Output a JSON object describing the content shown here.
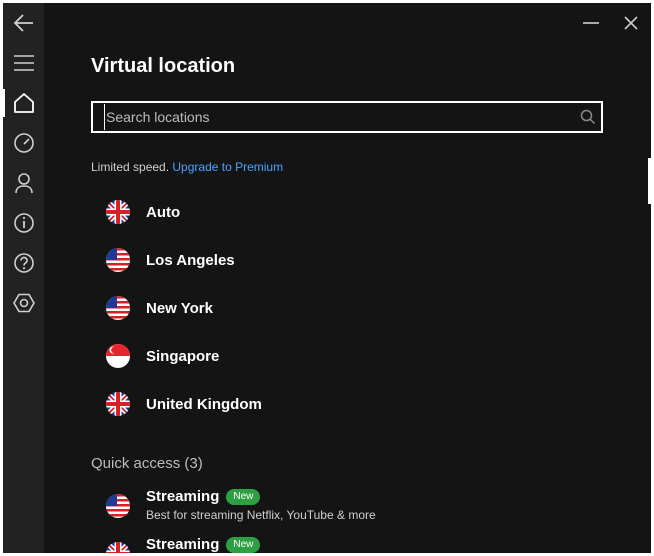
{
  "main": {
    "title": "Virtual location",
    "search_placeholder": "Search locations",
    "notice_text": "Limited speed. ",
    "upgrade_link": "Upgrade to Premium",
    "quick_access_title": "Quick access (3)"
  },
  "locations": [
    {
      "label": "Auto",
      "flag": "uk-flag-icon"
    },
    {
      "label": "Los Angeles",
      "flag": "us-flag-icon"
    },
    {
      "label": "New York",
      "flag": "us-flag-icon"
    },
    {
      "label": "Singapore",
      "flag": "singapore-flag-icon"
    },
    {
      "label": "United Kingdom",
      "flag": "uk-flag-icon"
    }
  ],
  "quick_access": [
    {
      "name": "Streaming",
      "badge": "New",
      "description": "Best for streaming Netflix, YouTube & more",
      "flag": "us-flag-icon"
    },
    {
      "name": "Streaming",
      "badge": "New",
      "description": "",
      "flag": "uk-flag-icon"
    }
  ],
  "sidebar_icons": [
    "back-arrow-icon",
    "menu-icon",
    "home-icon",
    "speedometer-icon",
    "user-icon",
    "info-icon",
    "help-icon",
    "settings-hexagon-icon"
  ],
  "colors": {
    "background": "#141414",
    "sidebar": "#222222",
    "link": "#4da3ff",
    "badge": "#2ea043"
  }
}
